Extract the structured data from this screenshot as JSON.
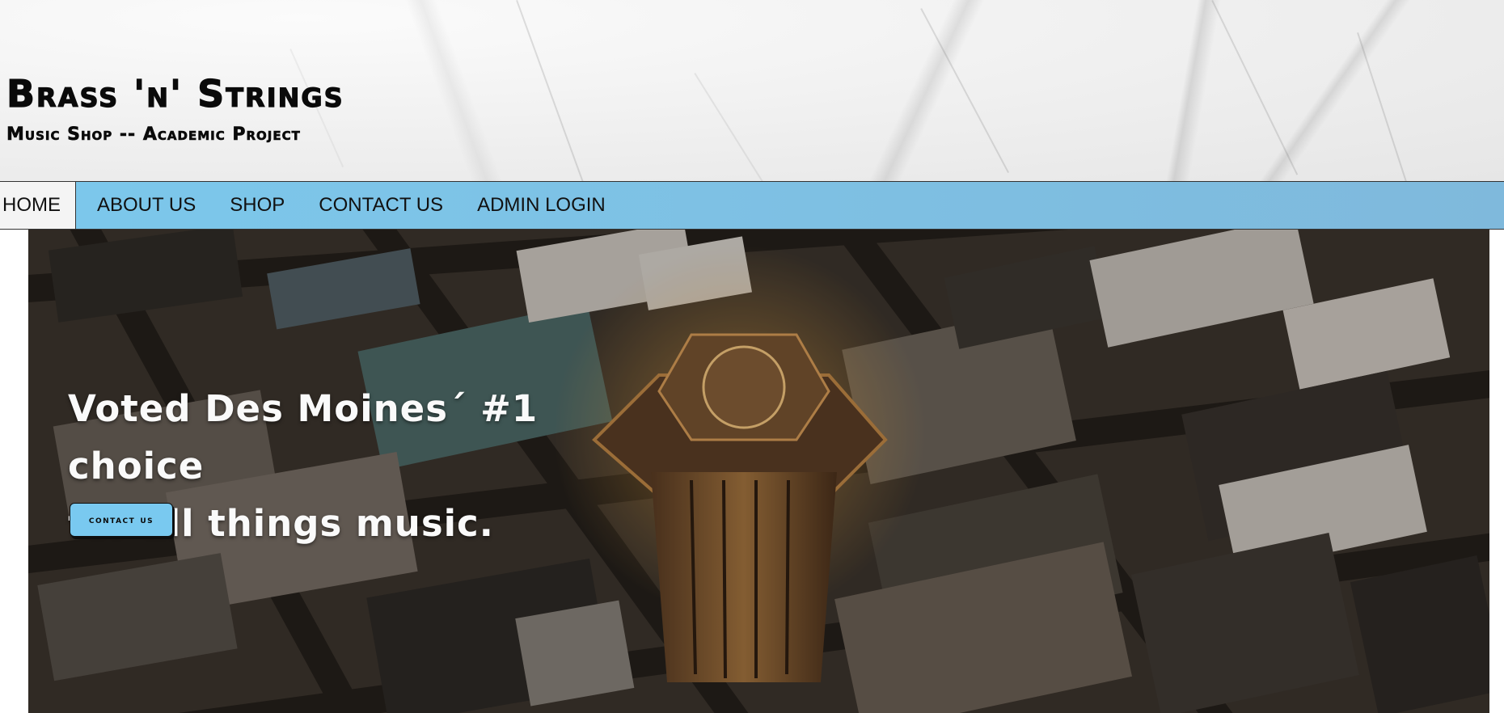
{
  "header": {
    "title": "Brass 'n' Strings",
    "subtitle": "Music Shop -- Academic Project"
  },
  "nav": {
    "items": [
      {
        "label": "HOME",
        "active": true
      },
      {
        "label": "ABOUT US",
        "active": false
      },
      {
        "label": "SHOP",
        "active": false
      },
      {
        "label": "CONTACT US",
        "active": false
      },
      {
        "label": "ADMIN LOGIN",
        "active": false
      }
    ]
  },
  "hero": {
    "headline_line1": "Voted Des Moines´ #1 choice",
    "headline_line2": "for all things music.",
    "button_label": "contact us",
    "image": "aerial-city-photo"
  },
  "colors": {
    "nav_bar": "#7cc8ec",
    "nav_active": "#f4f4f4",
    "button": "#79c9f0",
    "header_bg": "#efefef"
  }
}
